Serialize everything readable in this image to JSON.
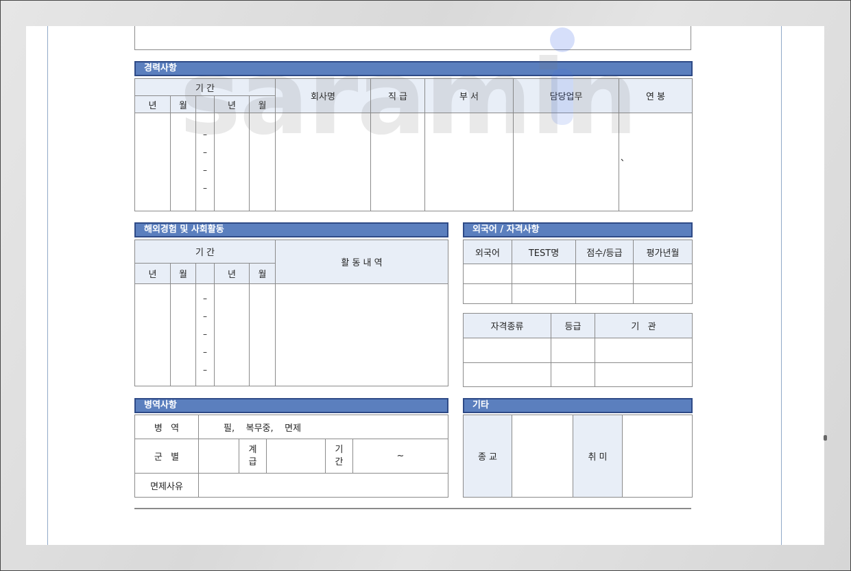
{
  "career": {
    "title": "경력사항",
    "headers": {
      "period": "기 간",
      "year": "년",
      "month": "월",
      "company": "회사명",
      "rank": "직 급",
      "dept": "부 서",
      "duty": "담당업무",
      "salary": "연 봉"
    },
    "dash": "–",
    "mark": "、"
  },
  "overseas": {
    "title": "해외경험 및 사회활동",
    "headers": {
      "period": "기 간",
      "year": "년",
      "month": "월",
      "activity": "활 동  내 역"
    },
    "dash": "–"
  },
  "language": {
    "title": "외국어 / 자격사항",
    "headers": [
      "외국어",
      "TEST명",
      "점수/등급",
      "평가년월"
    ],
    "cert_headers": [
      "자격종류",
      "등급",
      "기   관"
    ]
  },
  "military": {
    "title": "병역사항",
    "service_label": "병   역",
    "service_options": "필,    복무중,    면제",
    "branch_label": "군   별",
    "rank_label": "계\n급",
    "period_label": "기\n간",
    "tilde": "~",
    "exempt_label": "면제사유"
  },
  "etc": {
    "title": "기타",
    "religion_label": "종 교",
    "hobby_label": "취 미"
  },
  "watermark": "saramin",
  "colors": {
    "section_bar": "#5b7fbe",
    "header_cell": "#e8eef7",
    "brand_dot": "#466ee6"
  }
}
